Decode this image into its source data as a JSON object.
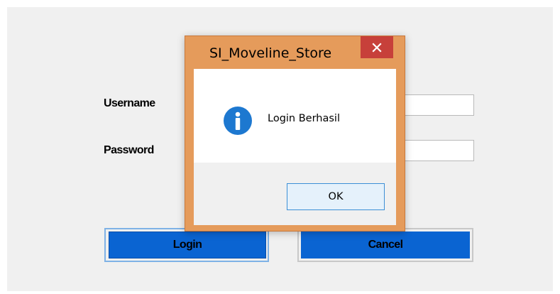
{
  "form": {
    "username_label": "Username",
    "password_label": "Password",
    "login_button": "Login",
    "cancel_button": "Cancel"
  },
  "dialog": {
    "title": "SI_Moveline_Store",
    "message": "Login Berhasil",
    "ok_button": "OK",
    "close_icon": "close-icon",
    "message_icon": "info-icon"
  },
  "colors": {
    "window_background": "#f0f0f0",
    "button_blue": "#0a64d2",
    "dialog_frame": "#e59b5b",
    "close_button": "#c7403a",
    "info_icon": "#1d78d0"
  }
}
